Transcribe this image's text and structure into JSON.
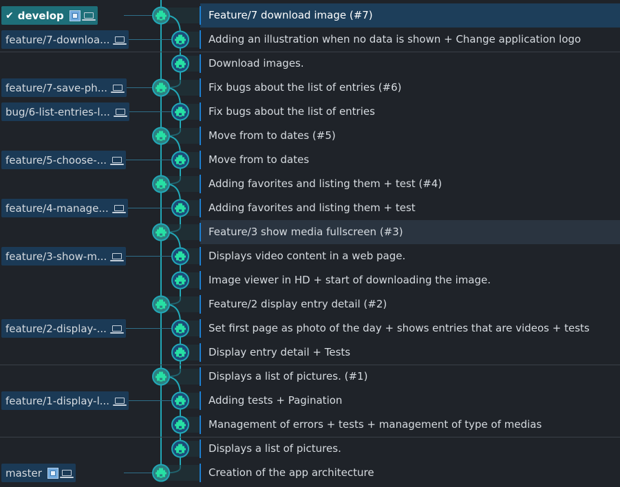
{
  "colors": {
    "background": "#1f2329",
    "graph_line": "#22a9b8",
    "avatar_blue": "#1c4a78",
    "avatar_teal": "#2d7f80",
    "avatar_glyph": "#27e0a4",
    "selected_row": "#1d3e5a",
    "branch_label": "#1b3a56",
    "active_branch": "#1e6f79"
  },
  "rows": [
    {
      "message": "Feature/7 download image (#7)",
      "branch": "develop",
      "active_branch": true,
      "avatar_icon": "merge-avatar-icon",
      "selected": true
    },
    {
      "message": "Adding an illustration when no data is shown + Change application logo",
      "branch": "feature/7-downloa...",
      "avatar_icon": "commit-avatar-icon",
      "separator": true
    },
    {
      "message": "Download images.",
      "avatar_icon": "commit-avatar-icon"
    },
    {
      "message": "Fix bugs about the list of entries (#6)",
      "branch": "feature/7-save-ph...",
      "avatar_icon": "merge-avatar-icon"
    },
    {
      "message": "Fix bugs about the list of entries",
      "branch": "bug/6-list-entries-l...",
      "avatar_icon": "commit-avatar-icon"
    },
    {
      "message": "Move from to dates (#5)",
      "avatar_icon": "merge-avatar-icon"
    },
    {
      "message": "Move from to dates",
      "branch": "feature/5-choose-...",
      "avatar_icon": "commit-avatar-icon"
    },
    {
      "message": "Adding favorites and listing them + test (#4)",
      "avatar_icon": "merge-avatar-icon"
    },
    {
      "message": "Adding favorites and listing them + test",
      "branch": "feature/4-manage...",
      "avatar_icon": "commit-avatar-icon"
    },
    {
      "message": "Feature/3 show media fullscreen (#3)",
      "avatar_icon": "merge-avatar-icon",
      "highlight": true
    },
    {
      "message": "Displays video content in a web page.",
      "branch": "feature/3-show-m...",
      "avatar_icon": "commit-avatar-icon"
    },
    {
      "message": "Image viewer in HD + start of downloading the image.",
      "avatar_icon": "commit-avatar-icon"
    },
    {
      "message": "Feature/2 display entry detail (#2)",
      "avatar_icon": "merge-avatar-icon"
    },
    {
      "message": "Set first page as photo of the day + shows entries that are videos + tests",
      "branch": "feature/2-display-...",
      "avatar_icon": "commit-avatar-icon"
    },
    {
      "message": "Display entry detail + Tests",
      "avatar_icon": "commit-avatar-icon",
      "separator": true
    },
    {
      "message": "Displays a list of pictures. (#1)",
      "avatar_icon": "merge-avatar-icon"
    },
    {
      "message": "Adding tests + Pagination",
      "branch": "feature/1-display-l...",
      "avatar_icon": "commit-avatar-icon"
    },
    {
      "message": "Management of errors + tests + management of type of medias",
      "avatar_icon": "commit-avatar-icon",
      "separator": true
    },
    {
      "message": "Displays a list of pictures.",
      "avatar_icon": "commit-avatar-icon"
    },
    {
      "message": "Creation of the app architecture",
      "branch": "master",
      "avatar_icon": "merge-avatar-icon",
      "remote": true
    }
  ]
}
